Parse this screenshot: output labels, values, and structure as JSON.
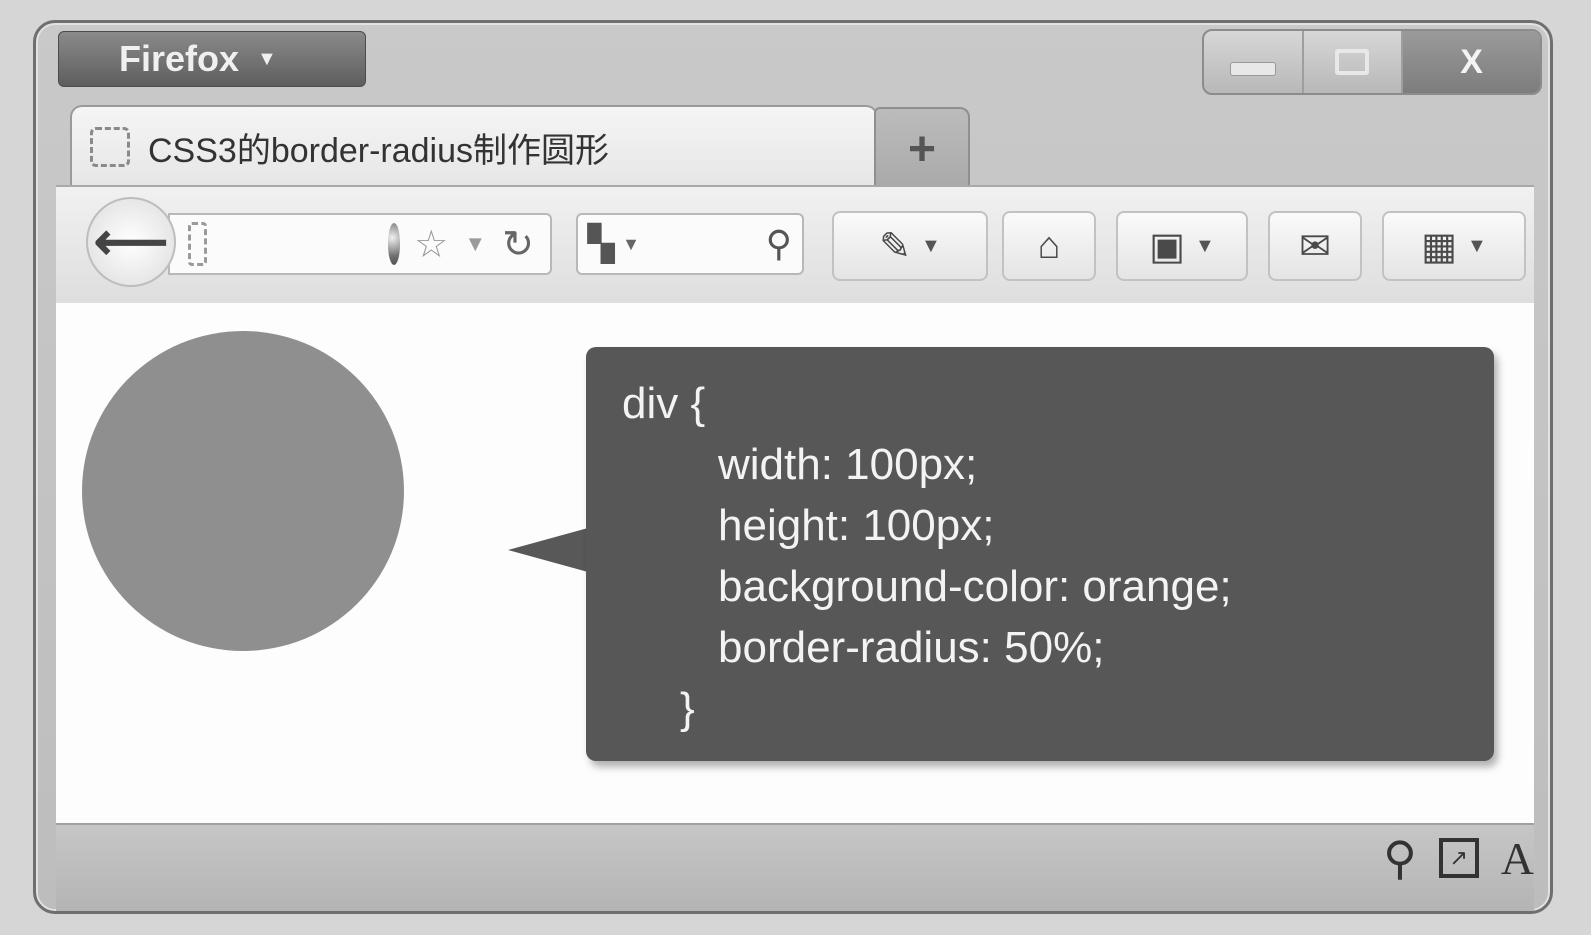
{
  "app": {
    "menu_label": "Firefox"
  },
  "window_controls": {
    "close_label": "X"
  },
  "tab": {
    "title": "CSS3的border-radius制作圆形"
  },
  "new_tab_label": "+",
  "colors": {
    "demo_circle": "#8f8f8f",
    "code_box_bg": "#575757",
    "code_text": "#f3f3f3"
  },
  "icons": {
    "back": "back-arrow-icon",
    "reload": "reload-icon",
    "bookmark_star": "star-icon",
    "search": "search-icon",
    "home": "home-icon",
    "bookmarks": "bookmarks-icon",
    "mail": "mail-icon",
    "addons": "addons-icon",
    "status_search": "magnifier-icon",
    "status_font": "font-icon"
  },
  "code": {
    "lines": [
      "div {",
      "width: 100px;",
      "height: 100px;",
      "background-color: orange;",
      "border-radius: 50%;",
      "}"
    ]
  },
  "statusbar": {
    "font_label": "A"
  }
}
